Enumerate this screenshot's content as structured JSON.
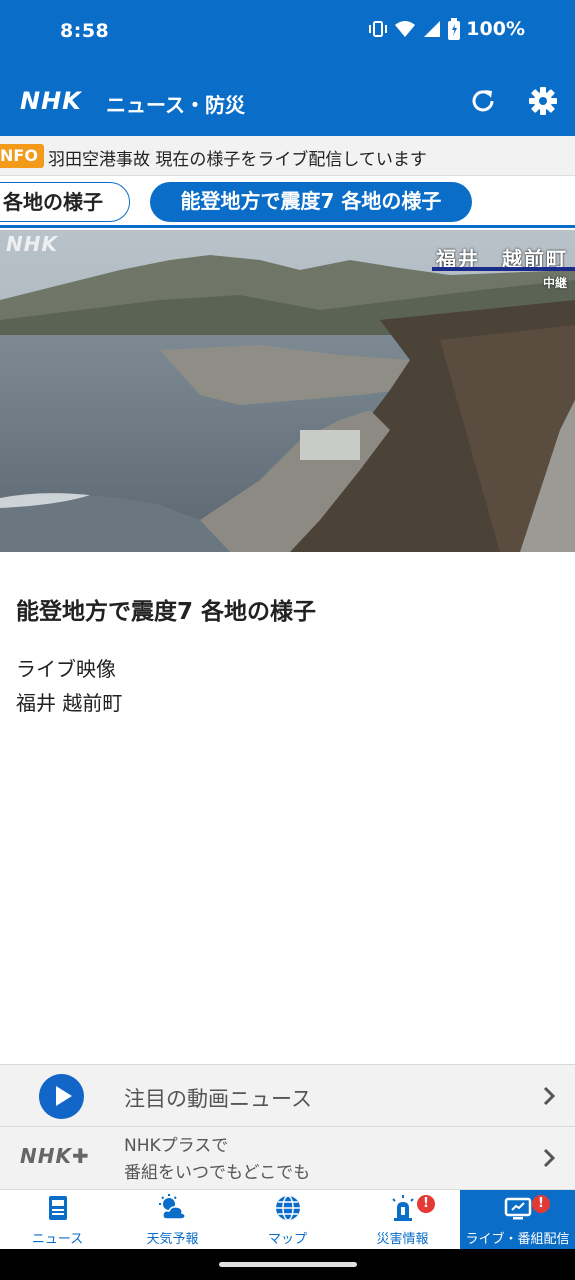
{
  "status_bar": {
    "time": "8:58",
    "battery": "100%",
    "icons": [
      "vibrate-icon",
      "wifi-icon",
      "signal-icon",
      "battery-icon"
    ]
  },
  "app_bar": {
    "logo": "NHK",
    "section": "ニュース・防災",
    "refresh_icon": "refresh-icon",
    "settings_icon": "gear-icon"
  },
  "ticker": {
    "badge": "NFO",
    "text": "羽田空港事故 現在の様子をライブ配信しています"
  },
  "tabs": [
    {
      "label": "各地の様子",
      "active": false
    },
    {
      "label": "能登地方で震度7 各地の様子",
      "active": true
    }
  ],
  "video": {
    "watermark": "NHK",
    "location": "福井　越前町",
    "relay": "中継"
  },
  "content": {
    "title": "能登地方で震度7 各地の様子",
    "line1": "ライブ映像",
    "line2": "福井 越前町"
  },
  "promos": {
    "video_news": "注目の動画ニュース",
    "plus_logo": "NHK✚",
    "plus_line1": "NHKプラスで",
    "plus_line2": "番組をいつでもどこでも"
  },
  "bottom_nav": [
    {
      "label": "ニュース",
      "icon": "newspaper-icon",
      "active": false,
      "alert": false
    },
    {
      "label": "天気予報",
      "icon": "weather-icon",
      "active": false,
      "alert": false
    },
    {
      "label": "マップ",
      "icon": "globe-icon",
      "active": false,
      "alert": false
    },
    {
      "label": "災害情報",
      "icon": "siren-icon",
      "active": false,
      "alert": true
    },
    {
      "label": "ライブ・番組配信",
      "icon": "tv-icon",
      "active": true,
      "alert": true
    }
  ],
  "alert_mark": "!",
  "colors": {
    "brand_blue": "#0a6dc8",
    "ticker_badge": "#f39a1b",
    "alert_red": "#e53935"
  }
}
